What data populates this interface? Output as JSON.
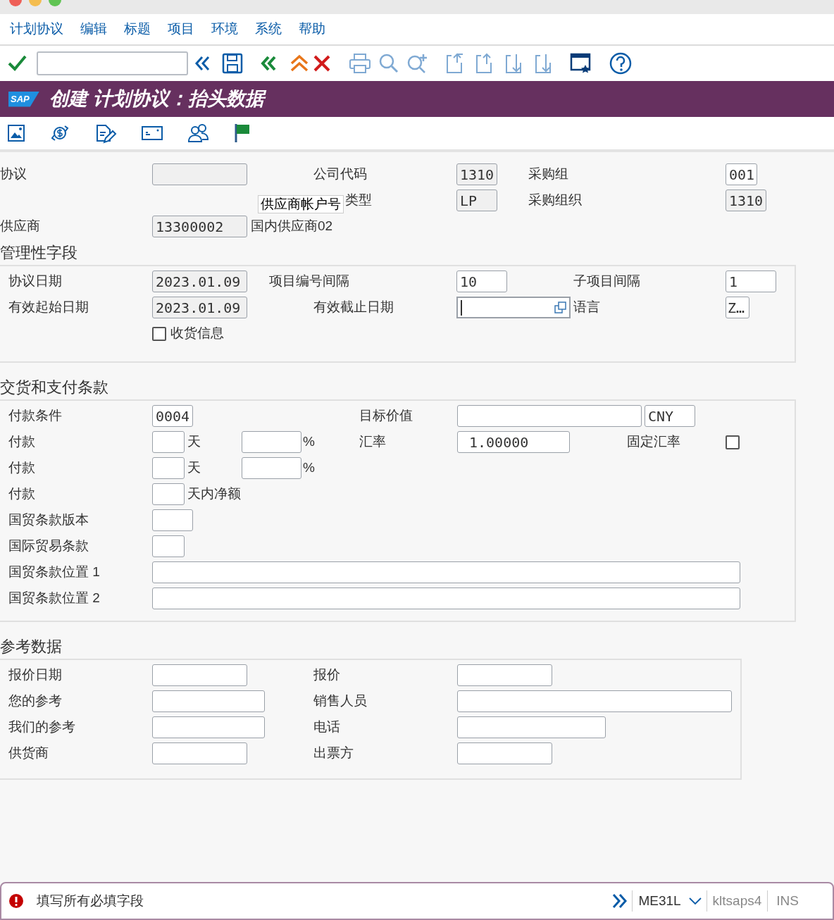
{
  "menu": [
    "计划协议",
    "编辑",
    "标题",
    "项目",
    "环境",
    "系统",
    "帮助"
  ],
  "logo": "SAP",
  "title": "创建 计划协议：抬头数据",
  "header": {
    "agreement": {
      "label": "协议",
      "readonly": true
    },
    "company_code": {
      "label": "公司代码",
      "value": "1310",
      "readonly": true
    },
    "purchasing_group": {
      "label": "采购组",
      "value": "001",
      "readonly": false
    },
    "agreement_type": {
      "label": "类型",
      "value": "LP",
      "readonly": true
    },
    "purchasing_org": {
      "label": "采购组织",
      "value": "1310",
      "readonly": true
    },
    "vendor": {
      "label": "供应商",
      "value": "13300002",
      "readonly": true,
      "name": "国内供应商02"
    },
    "tooltip": "供应商帐户号"
  },
  "admin": {
    "title": "管理性字段",
    "agreement_date": {
      "label": "协议日期",
      "value": "2023.01.09",
      "readonly": true
    },
    "item_interval": {
      "label": "项目编号间隔",
      "value": "10",
      "readonly": false
    },
    "subitem_interval": {
      "label": "子项目间隔",
      "value": "1",
      "readonly": false
    },
    "validity_start": {
      "label": "有效起始日期",
      "value": "2023.01.09",
      "readonly": true
    },
    "validity_end": {
      "label": "有效截止日期",
      "readonly": false
    },
    "language": {
      "label": "语言",
      "value": "Z…",
      "readonly": false
    },
    "gr_message": {
      "label": "收货信息",
      "checked": false
    }
  },
  "terms": {
    "title": "交货和支付条款",
    "payment_terms": {
      "label": "付款条件",
      "value": "0004"
    },
    "target_value": {
      "label": "目标价值",
      "currency": "CNY"
    },
    "payments": [
      {
        "label": "付款",
        "days_unit": "天",
        "percent_unit": "%"
      },
      {
        "label": "付款",
        "days_unit": "天",
        "percent_unit": "%"
      },
      {
        "label": "付款",
        "days_unit": "天内净额"
      }
    ],
    "exchange_rate": {
      "label": "汇率",
      "value": "1.00000"
    },
    "fixed_rate": {
      "label": "固定汇率",
      "checked": false
    },
    "incoterms_version": {
      "label": "国贸条款版本"
    },
    "incoterms": {
      "label": "国际贸易条款"
    },
    "incoterms_location_1": {
      "label": "国贸条款位置 1"
    },
    "incoterms_location_2": {
      "label": "国贸条款位置 2"
    }
  },
  "reference": {
    "title": "参考数据",
    "rows": [
      {
        "left": "报价日期",
        "right": "报价"
      },
      {
        "left": "您的参考",
        "right": "销售人员"
      },
      {
        "left": "我们的参考",
        "right": "电话"
      },
      {
        "left": "供货商",
        "right": "出票方"
      }
    ]
  },
  "status_bar": {
    "message": "填写所有必填字段",
    "transaction": "ME31L",
    "server": "kltsaps4",
    "mode": "INS"
  }
}
